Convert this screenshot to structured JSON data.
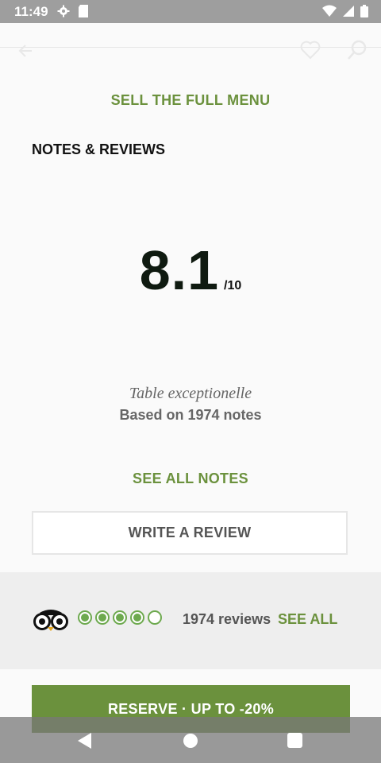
{
  "status_bar": {
    "time": "11:49",
    "icons_left": [
      "gear-icon",
      "sd-card-icon"
    ],
    "icons_right": [
      "wifi-icon",
      "signal-icon",
      "battery-icon"
    ]
  },
  "toolbar": {
    "icons": [
      "back-arrow-icon",
      "heart-icon",
      "search-icon"
    ]
  },
  "menu": {
    "link_label": "SELL THE FULL MENU"
  },
  "reviews": {
    "section_title": "NOTES & REVIEWS",
    "score": "8.1",
    "score_max": "/10",
    "score_label": "Table exceptionelle",
    "based_on": "Based on 1974 notes",
    "see_all_label": "SEE ALL NOTES",
    "write_review_label": "WRITE A REVIEW"
  },
  "tripadvisor": {
    "logo": "tripadvisor-owl-icon",
    "rating_bubbles": {
      "filled": 4,
      "total": 5
    },
    "review_count": "1974 reviews",
    "see_all_label": "SEE ALL"
  },
  "reserve": {
    "label": "RESERVE · UP TO -20%"
  },
  "colors": {
    "accent": "#6b913d",
    "bubble": "#6da94e",
    "background": "#fafafa"
  },
  "nav_bar": {
    "icons": [
      "nav-back-icon",
      "nav-home-icon",
      "nav-recent-icon"
    ]
  }
}
